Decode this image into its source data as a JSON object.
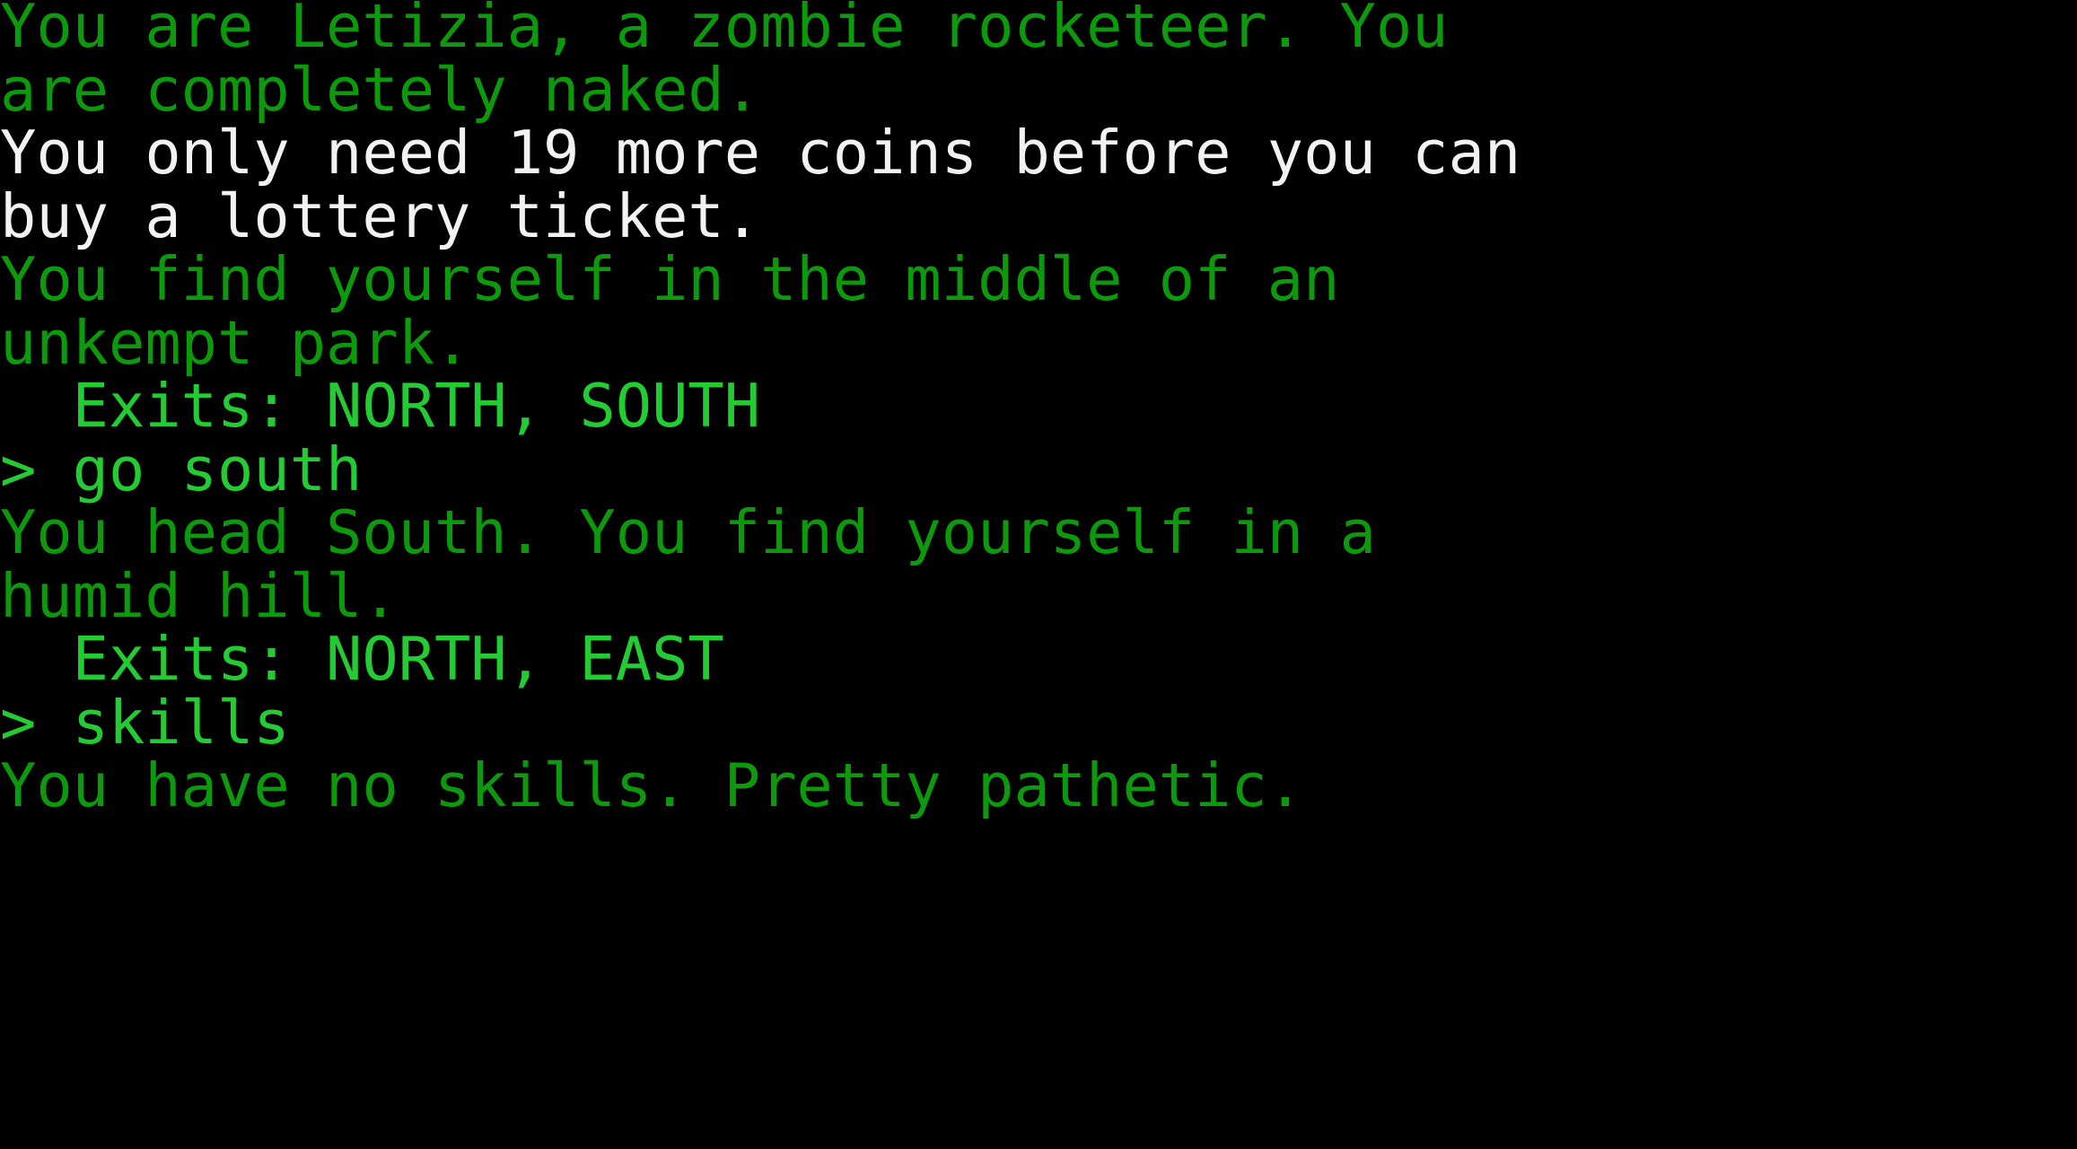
{
  "screen": {
    "kind": "text-adventure-terminal",
    "background_color": "#000000",
    "colors": {
      "narration_green": "#0c9a0c",
      "prompt_bright_green": "#24cc33",
      "system_white": "#f2f2f2"
    },
    "prompt_symbol": ">"
  },
  "game": {
    "character_name": "Letizia",
    "character_class": "zombie rocketeer",
    "coins_needed": 19,
    "current_room": "humid hill",
    "previous_room": "unkempt park"
  },
  "lines": [
    {
      "id": "intro-1",
      "name": "intro-line-1",
      "style": "c-green",
      "text": "You are Letizia, a zombie rocketeer. You"
    },
    {
      "id": "intro-2",
      "name": "intro-line-2",
      "style": "c-green",
      "text": "are completely naked."
    },
    {
      "id": "coins-1",
      "name": "coins-hint-line-1",
      "style": "c-white",
      "text": "You only need 19 more coins before you can"
    },
    {
      "id": "coins-2",
      "name": "coins-hint-line-2",
      "style": "c-white",
      "text": "buy a lottery ticket."
    },
    {
      "id": "room1-1",
      "name": "room-description-line-1",
      "style": "c-green",
      "text": "You find yourself in the middle of an"
    },
    {
      "id": "room1-2",
      "name": "room-description-line-2",
      "style": "c-green",
      "text": "unkempt park."
    },
    {
      "id": "exits1",
      "name": "exits-line-park",
      "style": "c-bright",
      "text": "  Exits: NORTH, SOUTH"
    },
    {
      "id": "cmd1",
      "name": "command-echo-go-south",
      "style": "c-bright",
      "text": "> go south"
    },
    {
      "id": "room2-1",
      "name": "move-result-line-1",
      "style": "c-green",
      "text": "You head South. You find yourself in a"
    },
    {
      "id": "room2-2",
      "name": "move-result-line-2",
      "style": "c-green",
      "text": "humid hill."
    },
    {
      "id": "exits2",
      "name": "exits-line-hill",
      "style": "c-bright",
      "text": "  Exits: NORTH, EAST"
    },
    {
      "id": "cmd2",
      "name": "command-echo-skills",
      "style": "c-bright",
      "text": "> skills"
    },
    {
      "id": "skills-1",
      "name": "skills-result-line-1",
      "style": "c-green",
      "text": "You have no skills. Pretty pathetic."
    }
  ]
}
